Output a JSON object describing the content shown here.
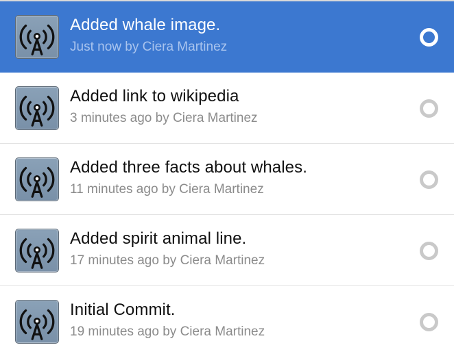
{
  "commits": [
    {
      "message": "Added whale image.",
      "time": "Just now",
      "by_text": "by",
      "author": "Ciera Martinez",
      "avatar_icon": "broadcast-antenna-icon",
      "selected": true
    },
    {
      "message": "Added link to wikipedia",
      "time": "3 minutes ago",
      "by_text": "by",
      "author": "Ciera Martinez",
      "avatar_icon": "broadcast-antenna-icon",
      "selected": false
    },
    {
      "message": "Added three facts about whales.",
      "time": "11 minutes ago",
      "by_text": "by",
      "author": "Ciera Martinez",
      "avatar_icon": "broadcast-antenna-icon",
      "selected": false
    },
    {
      "message": "Added spirit animal line.",
      "time": "17 minutes ago",
      "by_text": "by",
      "author": "Ciera Martinez",
      "avatar_icon": "broadcast-antenna-icon",
      "selected": false
    },
    {
      "message": "Initial Commit.",
      "time": "19 minutes ago",
      "by_text": "by",
      "author": "Ciera Martinez",
      "avatar_icon": "broadcast-antenna-icon",
      "selected": false
    }
  ],
  "colors": {
    "selected_background": "#3c78d0",
    "selected_meta_text": "#a9c4ee",
    "meta_text": "#8b8b8b",
    "radio_border": "#c9c9c9"
  }
}
